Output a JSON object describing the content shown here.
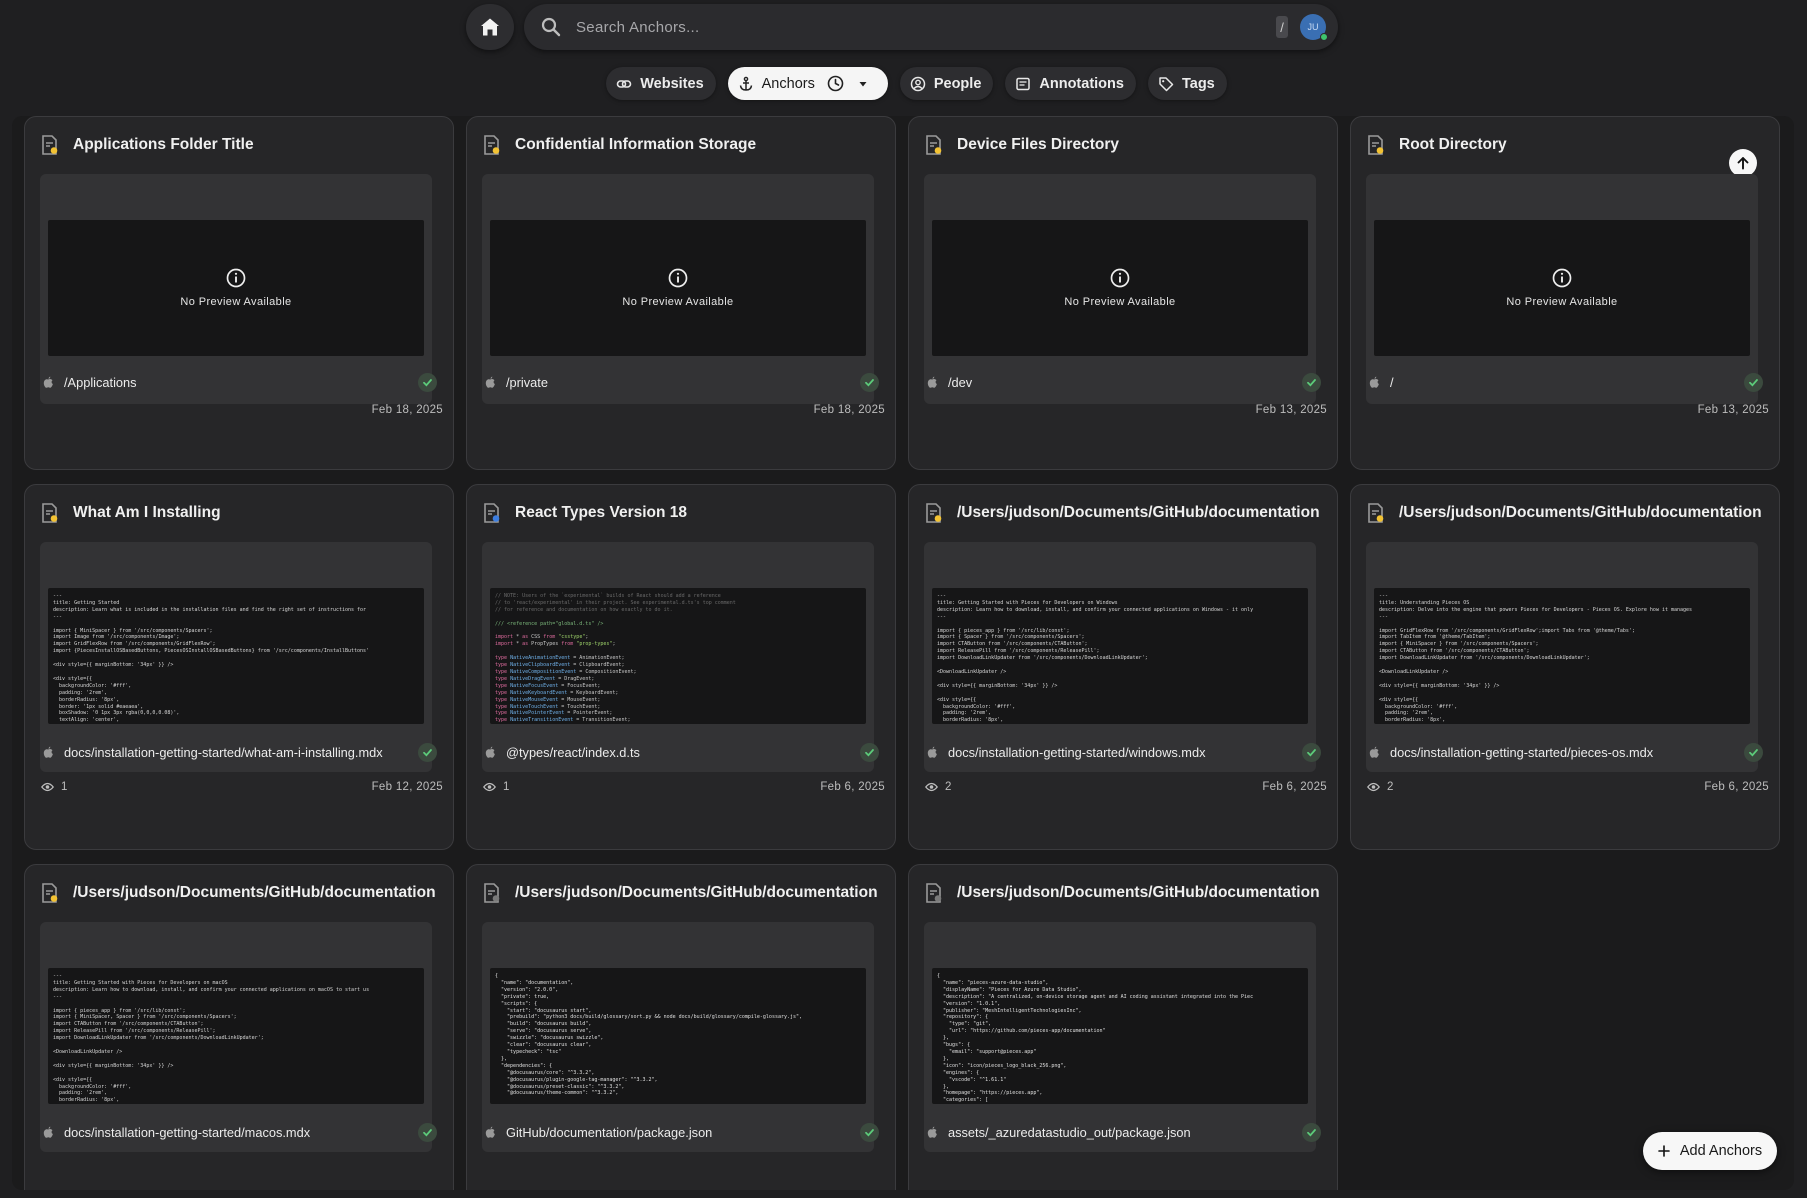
{
  "search": {
    "placeholder": "Search Anchors...",
    "shortcut": "/",
    "avatar_initials": "JU"
  },
  "tabs": [
    {
      "label": "Websites",
      "icon": "link-icon",
      "active": false
    },
    {
      "label": "Anchors",
      "icon": "anchor-icon",
      "active": true
    },
    {
      "label": "People",
      "icon": "person-icon",
      "active": false
    },
    {
      "label": "Annotations",
      "icon": "note-icon",
      "active": false
    },
    {
      "label": "Tags",
      "icon": "tag-icon",
      "active": false
    }
  ],
  "no_preview_text": "No Preview Available",
  "add_button_label": "Add Anchors",
  "colors": {
    "background": "#1f1f21",
    "card": "#262628",
    "accent_check": "#5ccb7a",
    "file_icon_badge": "#f2c233"
  },
  "cards": [
    {
      "title": "Applications Folder Title",
      "path": "/Applications",
      "date": "Feb 18, 2025",
      "views": "",
      "preview": "none"
    },
    {
      "title": "Confidential Information Storage",
      "path": "/private",
      "date": "Feb 18, 2025",
      "views": "",
      "preview": "none"
    },
    {
      "title": "Device Files Directory",
      "path": "/dev",
      "date": "Feb 13, 2025",
      "views": "",
      "preview": "none"
    },
    {
      "title": "Root Directory",
      "path": "/",
      "date": "Feb 13, 2025",
      "views": "",
      "preview": "none"
    },
    {
      "title": "What Am I Installing",
      "path": "docs/installation-getting-started/what-am-i-installing.mdx",
      "date": "Feb 12, 2025",
      "views": "1",
      "preview": "code"
    },
    {
      "title": "React Types Version 18",
      "path": "@types/react/index.d.ts",
      "date": "Feb 6, 2025",
      "views": "1",
      "preview": "code"
    },
    {
      "title": "/Users/judson/Documents/GitHub/documentation/docs/installation-getting-started/windows.mdx",
      "path": "docs/installation-getting-started/windows.mdx",
      "date": "Feb 6, 2025",
      "views": "2",
      "preview": "code"
    },
    {
      "title": "/Users/judson/Documents/GitHub/documentation/docs/installation-getting-started/pieces-os.mdx",
      "path": "docs/installation-getting-started/pieces-os.mdx",
      "date": "Feb 6, 2025",
      "views": "2",
      "preview": "code"
    },
    {
      "title": "/Users/judson/Documents/GitHub/documentation/docs/installation-getting-started/macos.mdx",
      "path": "docs/installation-getting-started/macos.mdx",
      "date": "",
      "views": "",
      "preview": "code"
    },
    {
      "title": "/Users/judson/Documents/GitHub/documentation/package.json",
      "path": "GitHub/documentation/package.json",
      "date": "",
      "views": "",
      "preview": "code"
    },
    {
      "title": "/Users/judson/Documents/GitHub/documentation/static/assets/_azuredatastudio_out/package.json",
      "path": "assets/_azuredatastudio_out/package.json",
      "date": "",
      "views": "",
      "preview": "code"
    }
  ],
  "code_previews": {
    "what_am_i_installing": "---\ntitle: Getting Started\ndescription: Learn what is included in the installation files and find the right set of instructions for\n---\n\nimport { MiniSpacer } from '/src/components/Spacers';\nimport Image from '/src/components/Image';\nimport GridFlexRow from '/src/components/GridFlexRow';\nimport {PiecesInstallOSBasedButtons, PiecesOSInstallOSBasedButtons} from '/src/components/InstallButtons'\n\n<div style={{ marginBottom: '34px' }} />\n\n<div style={{\n  backgroundColor: '#fff',\n  padding: '2rem',\n  borderRadius: '8px',\n  border: '1px solid #eaeaea',\n  boxShadow: '0 1px 3px rgba(0,0,0,0.08)',\n  textAlign: 'center',",
    "windows": "---\ntitle: Getting Started with Pieces for Developers on Windows\ndescription: Learn how to download, install, and confirm your connected applications on Windows - it only\n---\n\nimport { pieces_app } from '/src/lib/const';\nimport { Spacer } from '/src/components/Spacers';\nimport CTAButton from '/src/components/CTAButton';\nimport ReleasePill from '/src/components/ReleasePill';\nimport DownloadLinkUpdater from '/src/components/DownloadLinkUpdater';\n\n<DownloadLinkUpdater />\n\n<div style={{ marginBottom: '34px' }} />\n\n<div style={{\n  backgroundColor: '#fff',\n  padding: '2rem',\n  borderRadius: '8px',",
    "pieces_os": "---\ntitle: Understanding Pieces OS\ndescription: Delve into the engine that powers Pieces for Developers - Pieces OS. Explore how it manages\n---\n\nimport GridFlexRow from '/src/components/GridFlexRow';import Tabs from '@theme/Tabs';\nimport TabItem from '@theme/TabItem';\nimport { MiniSpacer } from '/src/components/Spacers';\nimport CTAButton from '/src/components/CTAButton';\nimport DownloadLinkUpdater from '/src/components/DownloadLinkUpdater';\n\n<DownloadLinkUpdater />\n\n<div style={{ marginBottom: '34px' }} />\n\n<div style={{\n  backgroundColor: '#fff',\n  padding: '2rem',\n  borderRadius: '8px',",
    "macos": "---\ntitle: Getting Started with Pieces for Developers on macOS\ndescription: Learn how to download, install, and confirm your connected applications on macOS to start us\n---\n\nimport { pieces_app } from '/src/lib/const';\nimport { MiniSpacer, Spacer } from '/src/components/Spacers';\nimport CTAButton from '/src/components/CTAButton';\nimport ReleasePill from '/src/components/ReleasePill';\nimport DownloadLinkUpdater from '/src/components/DownloadLinkUpdater';\n\n<DownloadLinkUpdater />\n\n<div style={{ marginBottom: '34px' }} />\n\n<div style={{\n  backgroundColor: '#fff',\n  padding: '2rem',\n  borderRadius: '8px',",
    "package_json": "{\n  \"name\": \"documentation\",\n  \"version\": \"2.0.0\",\n  \"private\": true,\n  \"scripts\": {\n    \"start\": \"docusaurus start\",\n    \"prebuild\": \"python3 docs/build/glossary/sort.py && node docs/build/glossary/compile-glossary.js\",\n    \"build\": \"docusaurus build\",\n    \"serve\": \"docusaurus serve\",\n    \"swizzle\": \"docusaurus swizzle\",\n    \"clear\": \"docusaurus clear\",\n    \"typecheck\": \"tsc\"\n  },\n  \"dependencies\": {\n    \"@docusaurus/core\": \"^3.3.2\",\n    \"@docusaurus/plugin-google-tag-manager\": \"^3.3.2\",\n    \"@docusaurus/preset-classic\": \"^3.3.2\",\n    \"@docusaurus/theme-common\": \"^3.3.2\",",
    "azure_package_json": "{\n  \"name\": \"pieces-azure-data-studio\",\n  \"displayName\": \"Pieces for Azure Data Studio\",\n  \"description\": \"A centralized, on-device storage agent and AI coding assistant integrated into the Piec\n  \"version\": \"1.0.1\",\n  \"publisher\": \"MeshIntelligentTechnologiesInc\",\n  \"repository\": {\n    \"type\": \"git\",\n    \"url\": \"https://github.com/pieces-app/documentation\"\n  },\n  \"bugs\": {\n    \"email\": \"support@pieces.app\"\n  },\n  \"icon\": \"icon/pieces_logo_black_256.png\",\n  \"engines\": {\n    \"vscode\": \"^1.61.1\"\n  },\n  \"homepage\": \"https://pieces.app\",\n  \"categories\": ["
  }
}
